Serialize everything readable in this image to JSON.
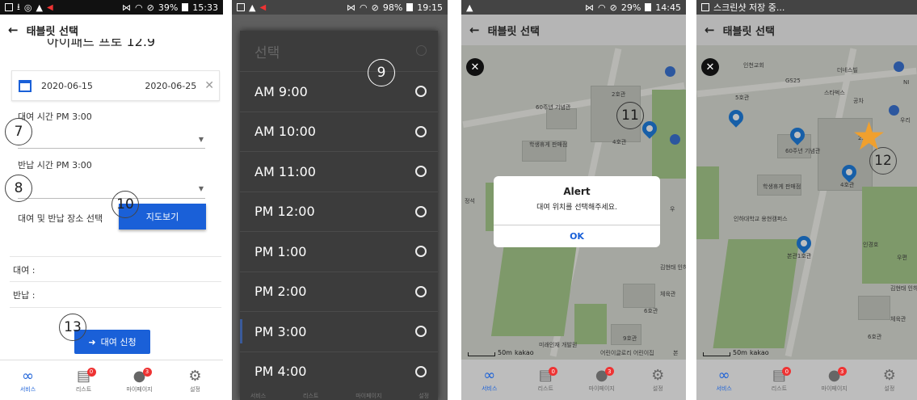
{
  "screen1": {
    "status": {
      "time": "15:33",
      "battery": "39%"
    },
    "title": "태블릿 선택",
    "cut_title": "아이패드 프로 12.9",
    "date_start": "2020-06-15",
    "date_end": "2020-06-25",
    "rent_time_label": "대여 시간 PM 3:00",
    "return_time_label": "반납 시간 PM 3:00",
    "place_label": "대여 및 반납 장소 선택",
    "map_button": "지도보기",
    "rent_field": "대여 :",
    "return_field": "반납 :",
    "rent_button": "대여 신청",
    "annotations": {
      "a7": "7",
      "a8": "8",
      "a10": "10",
      "a13": "13"
    }
  },
  "screen2": {
    "status": {
      "time": "19:15",
      "battery": "98%"
    },
    "modal_title": "선택",
    "options": [
      "AM 9:00",
      "AM 10:00",
      "AM 11:00",
      "PM 12:00",
      "PM 1:00",
      "PM 2:00",
      "PM 3:00",
      "PM 4:00"
    ],
    "annotation": "9",
    "bottom_labels": [
      "서비스",
      "리스트",
      "마이페이지",
      "설정"
    ]
  },
  "screen3": {
    "status": {
      "time": "14:45",
      "battery": "29%"
    },
    "title": "태블릿 선택",
    "alert_title": "Alert",
    "alert_message": "대여 위치를 선택해주세요.",
    "alert_ok": "OK",
    "annotation": "11",
    "map_labels": {
      "b1": "2호관",
      "b2": "60주년\n기념관",
      "b3": "4호관",
      "b4": "학생휴게\n판매점",
      "b5": "김현태\n인하드림",
      "b6": "체육관",
      "b7": "6호관",
      "b8": "9호관",
      "b9": "미래인재\n개발원",
      "b10": "어린이글로리\n어린이집",
      "b11": "우",
      "b12": "본",
      "b13": "정석"
    },
    "scale": "50m",
    "kakao": "kakao"
  },
  "screen4": {
    "status_text": "스크린샷 저장 중...",
    "title": "태블릿 선택",
    "annotation": "12",
    "map_labels": {
      "l1": "인천교회",
      "l2": "더네스빌",
      "l3": "GS25",
      "l4": "스타벅스",
      "l5": "공차",
      "l6": "5호관",
      "l7": "2호관",
      "l8": "60주년\n기념관",
      "l9": "4호관",
      "l10": "학생휴게\n판매점",
      "l11": "인하대학교\n용현캠퍼스",
      "l12": "인경호",
      "l13": "본관1호관",
      "l14": "우편",
      "l15": "김현태\n인하드림센",
      "l16": "체육관",
      "l17": "6호관",
      "l18": "NI",
      "l19": "우리"
    },
    "scale": "50m",
    "kakao": "kakao"
  },
  "nav": {
    "items": [
      {
        "label": "서비스",
        "icon": "link-icon",
        "badge": ""
      },
      {
        "label": "리스트",
        "icon": "list-icon",
        "badge": "0"
      },
      {
        "label": "마이페이지",
        "icon": "person-icon",
        "badge": "3"
      },
      {
        "label": "설정",
        "icon": "gear-icon",
        "badge": ""
      }
    ]
  },
  "colors": {
    "primary": "#1a60d8",
    "badge": "#e33333",
    "star": "#f0a02e",
    "modal": "#3c3c3c"
  }
}
